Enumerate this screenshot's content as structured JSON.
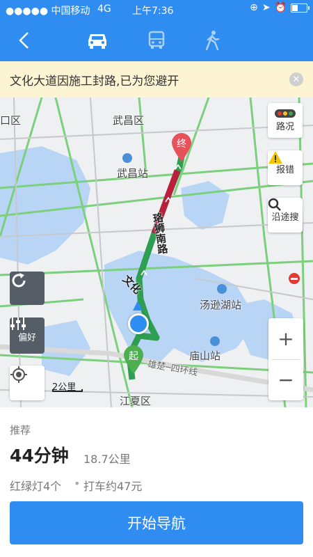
{
  "status_bar": {
    "carrier": "●●●●● 中国移动",
    "network": "4G",
    "time": "上午7:36"
  },
  "nav": {
    "back_icon": "chevron-left-icon",
    "modes": [
      "car-icon",
      "bus-icon",
      "walk-icon"
    ]
  },
  "notice": {
    "text": "文化大道因施工封路,已为您避开",
    "close_icon": "close-icon"
  },
  "map": {
    "labels": {
      "district_top_left": "口区",
      "wuchang_district": "武昌区",
      "wuchang_station": "武昌站",
      "tangxun_station": "汤逊湖站",
      "miaoshan_station": "庙山站",
      "jiangxia_district": "江夏区",
      "luoshi_road": "珞狮南路",
      "wenhua_road": "文化",
      "ring_road": "雄楚─四环线",
      "end_marker": "终",
      "start_marker": "起"
    },
    "right_buttons": {
      "traffic": "路况",
      "report": "报错",
      "along_search": "沿途搜"
    },
    "left_buttons": {
      "preference": "偏好"
    },
    "scale": "2公里",
    "zoom_in": "+",
    "zoom_out": "−"
  },
  "route": {
    "recommend_label": "推荐",
    "duration": "44分钟",
    "distance": "18.7公里",
    "traffic_lights": "红绿灯4个",
    "taxi_fare": "打车约47元",
    "start_button": "开始导航"
  },
  "colors": {
    "primary": "#2f8cf0",
    "route_green": "#3db35a",
    "route_red": "#c0203a",
    "notice_bg": "#fdf4d3"
  }
}
